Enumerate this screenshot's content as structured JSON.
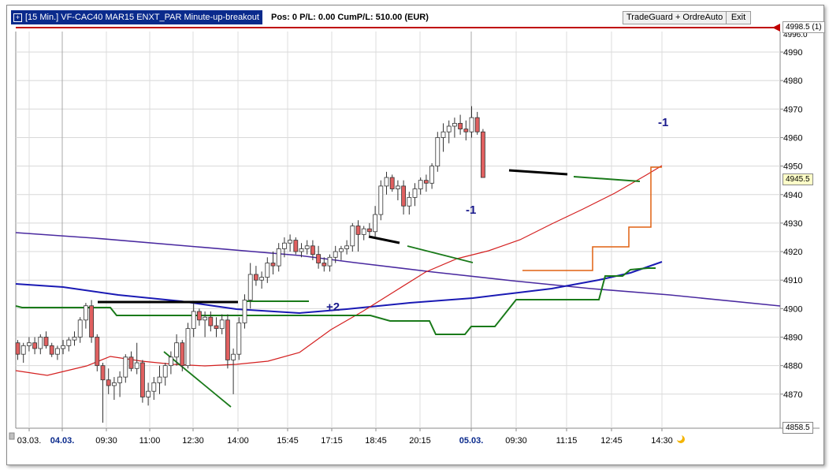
{
  "title_bar": {
    "instrument_label": "[15 Min.] VF-CAC40 MAR15    ENXT_PAR Minute-up-breakout",
    "stats": "Pos: 0  P/L: 0.00  CumP/L: 510.00 (EUR)",
    "tradeguard_button": "TradeGuard + OrdreAuto",
    "exit_button": "Exit"
  },
  "price_axis": {
    "ticks": [
      "4990",
      "4980",
      "4970",
      "4960",
      "4950",
      "4940",
      "4930",
      "4920",
      "4910",
      "4900",
      "4890",
      "4880",
      "4870"
    ],
    "top_partial": "4996.0",
    "current_price": "4945.5",
    "low_price": "4858.5",
    "order_line_label": "4998.5 (1)"
  },
  "time_axis": {
    "labels": [
      "03.03.",
      "04.03.",
      "09:30",
      "11:00",
      "12:30",
      "14:00",
      "15:45",
      "17:15",
      "18:45",
      "20:15",
      "05.03.",
      "09:30",
      "11:15",
      "12:45",
      "14:30"
    ]
  },
  "annotations": {
    "entry_plus2": "+2",
    "exit_minus1_a": "-1",
    "exit_minus1_b": "-1"
  },
  "colors": {
    "title_bg": "#0a2a8c",
    "bull_candle": "#ffffff",
    "bear_candle": "#e06060",
    "ma_red": "#d42020",
    "ma_blue": "#1a1ab4",
    "ma_purple": "#4a2aa0",
    "channel_green": "#1a7a1a",
    "stop_orange": "#e06010",
    "order_line": "#c00000"
  },
  "chart_data": {
    "type": "candlestick",
    "ylim": [
      4858.5,
      4996
    ],
    "candles": [
      [
        4888,
        4889,
        4882,
        4884
      ],
      [
        4884,
        4888,
        4881,
        4887
      ],
      [
        4887,
        4890,
        4885,
        4888
      ],
      [
        4888,
        4890,
        4884,
        4886
      ],
      [
        4886,
        4891,
        4884,
        4890
      ],
      [
        4890,
        4892,
        4886,
        4887
      ],
      [
        4887,
        4888,
        4883,
        4884
      ],
      [
        4884,
        4887,
        4882,
        4886
      ],
      [
        4886,
        4889,
        4884,
        4887
      ],
      [
        4887,
        4890,
        4885,
        4889
      ],
      [
        4889,
        4892,
        4887,
        4890
      ],
      [
        4890,
        4897,
        4888,
        4896
      ],
      [
        4896,
        4902,
        4893,
        4901
      ],
      [
        4901,
        4903,
        4888,
        4890
      ],
      [
        4890,
        4891,
        4878,
        4880
      ],
      [
        4880,
        4881,
        4860,
        4875
      ],
      [
        4875,
        4879,
        4870,
        4873
      ],
      [
        4873,
        4876,
        4868,
        4874
      ],
      [
        4874,
        4878,
        4869,
        4876
      ],
      [
        4876,
        4884,
        4874,
        4883
      ],
      [
        4883,
        4885,
        4878,
        4879
      ],
      [
        4879,
        4888,
        4877,
        4881
      ],
      [
        4881,
        4882,
        4867,
        4869
      ],
      [
        4869,
        4874,
        4866,
        4871
      ],
      [
        4871,
        4876,
        4868,
        4874
      ],
      [
        4874,
        4880,
        4870,
        4876
      ],
      [
        4876,
        4881,
        4873,
        4880
      ],
      [
        4880,
        4885,
        4877,
        4883
      ],
      [
        4883,
        4891,
        4880,
        4888
      ],
      [
        4888,
        4889,
        4878,
        4880
      ],
      [
        4880,
        4895,
        4879,
        4893
      ],
      [
        4893,
        4902,
        4890,
        4899
      ],
      [
        4899,
        4900,
        4894,
        4896
      ],
      [
        4896,
        4899,
        4890,
        4897
      ],
      [
        4897,
        4899,
        4892,
        4894
      ],
      [
        4894,
        4897,
        4890,
        4893
      ],
      [
        4893,
        4898,
        4891,
        4896
      ],
      [
        4896,
        4898,
        4879,
        4882
      ],
      [
        4882,
        4886,
        4870,
        4884
      ],
      [
        4884,
        4897,
        4882,
        4895
      ],
      [
        4895,
        4905,
        4893,
        4903
      ],
      [
        4903,
        4916,
        4900,
        4912
      ],
      [
        4912,
        4915,
        4908,
        4910
      ],
      [
        4910,
        4913,
        4907,
        4911
      ],
      [
        4911,
        4918,
        4909,
        4916
      ],
      [
        4916,
        4920,
        4912,
        4915
      ],
      [
        4915,
        4923,
        4913,
        4921
      ],
      [
        4921,
        4925,
        4918,
        4923
      ],
      [
        4923,
        4926,
        4920,
        4924
      ],
      [
        4924,
        4925,
        4919,
        4920
      ],
      [
        4920,
        4923,
        4918,
        4921
      ],
      [
        4921,
        4924,
        4919,
        4922
      ],
      [
        4922,
        4924,
        4917,
        4919
      ],
      [
        4919,
        4922,
        4914,
        4916
      ],
      [
        4916,
        4918,
        4913,
        4915
      ],
      [
        4915,
        4919,
        4913,
        4918
      ],
      [
        4918,
        4922,
        4916,
        4920
      ],
      [
        4920,
        4922,
        4917,
        4921
      ],
      [
        4921,
        4924,
        4919,
        4922
      ],
      [
        4922,
        4930,
        4920,
        4929
      ],
      [
        4929,
        4931,
        4920,
        4926
      ],
      [
        4926,
        4929,
        4924,
        4928
      ],
      [
        4928,
        4930,
        4925,
        4927
      ],
      [
        4927,
        4936,
        4925,
        4933
      ],
      [
        4933,
        4945,
        4931,
        4943
      ],
      [
        4943,
        4948,
        4940,
        4946
      ],
      [
        4946,
        4947,
        4941,
        4942
      ],
      [
        4942,
        4945,
        4938,
        4943
      ],
      [
        4943,
        4945,
        4933,
        4936
      ],
      [
        4936,
        4941,
        4933,
        4939
      ],
      [
        4939,
        4944,
        4936,
        4942
      ],
      [
        4942,
        4946,
        4940,
        4945
      ],
      [
        4945,
        4947,
        4941,
        4944
      ],
      [
        4944,
        4951,
        4942,
        4950
      ],
      [
        4950,
        4962,
        4948,
        4960
      ],
      [
        4960,
        4965,
        4955,
        4962
      ],
      [
        4962,
        4966,
        4958,
        4964
      ],
      [
        4964,
        4967,
        4960,
        4965
      ],
      [
        4965,
        4968,
        4961,
        4963
      ],
      [
        4963,
        4966,
        4959,
        4962
      ],
      [
        4962,
        4971,
        4960,
        4967
      ],
      [
        4967,
        4969,
        4961,
        4962
      ],
      [
        4962,
        4963,
        4946,
        4946
      ]
    ]
  }
}
